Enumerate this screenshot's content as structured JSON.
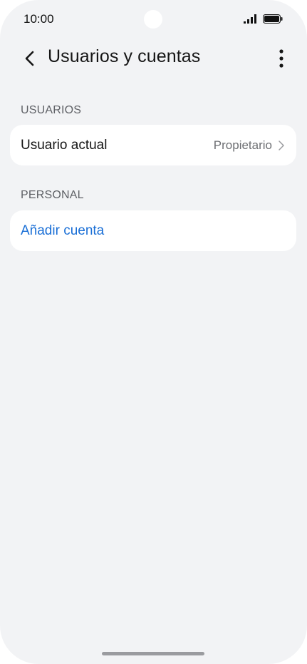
{
  "status_bar": {
    "time": "10:00",
    "signal_icon": "signal-bars-icon",
    "battery_icon": "battery-icon"
  },
  "app_bar": {
    "title": "Usuarios y cuentas",
    "back_icon": "back-arrow-icon",
    "more_icon": "more-options-icon"
  },
  "sections": {
    "users": {
      "label": "USUARIOS",
      "current_user_title": "Usuario actual",
      "current_user_value": "Propietario"
    },
    "personal": {
      "label": "PERSONAL",
      "add_account_label": "Añadir cuenta"
    }
  },
  "colors": {
    "background": "#f2f3f5",
    "card": "#ffffff",
    "accent_link": "#1a6fd6",
    "secondary_text": "#6d6f73"
  }
}
